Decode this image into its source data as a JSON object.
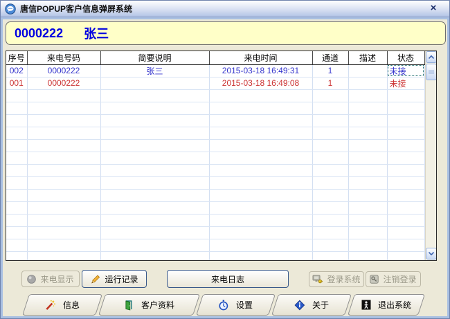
{
  "window": {
    "title": "唐信POPUP客户信息弹屏系统",
    "close_glyph": "×"
  },
  "banner": {
    "number": "0000222",
    "name": "张三"
  },
  "table": {
    "columns": [
      "序号",
      "来电号码",
      "简要说明",
      "来电时间",
      "通道",
      "描述",
      "状态"
    ],
    "rows": [
      {
        "seq": "002",
        "number": "0000222",
        "note": "张三",
        "time": "2015-03-18 16:49:31",
        "channel": "1",
        "desc": "",
        "status": "未接",
        "color": "blue",
        "status_focused": true
      },
      {
        "seq": "001",
        "number": "0000222",
        "note": "",
        "time": "2015-03-18 16:49:08",
        "channel": "1",
        "desc": "",
        "status": "未接",
        "color": "red",
        "status_focused": false
      }
    ],
    "empty_row_count": 14
  },
  "buttons": {
    "display": {
      "label": "来电显示",
      "enabled": false
    },
    "run": {
      "label": "运行记录",
      "enabled": true
    },
    "log": {
      "label": "来电日志",
      "enabled": true
    },
    "login": {
      "label": "登录系统",
      "enabled": false
    },
    "logout": {
      "label": "注销登录",
      "enabled": false
    }
  },
  "tabs": [
    {
      "label": "信息",
      "icon": "magic-wand-icon"
    },
    {
      "label": "客户资料",
      "icon": "open-door-icon"
    },
    {
      "label": "设置",
      "icon": "stopwatch-icon"
    },
    {
      "label": "关于",
      "icon": "info-diamond-icon"
    },
    {
      "label": "退出系统",
      "icon": "exit-person-icon"
    }
  ],
  "colors": {
    "row_blue": "#3333CC",
    "row_red": "#CC3333",
    "banner_text": "#0000E0",
    "banner_bg": "#FFFFC8",
    "window_bg": "#ECE9D8",
    "titlebar_top": "#FEFEFE",
    "titlebar_bottom": "#B3C4E6",
    "frame_border": "#A9C0E2",
    "grid_line": "#D3DFF2"
  }
}
